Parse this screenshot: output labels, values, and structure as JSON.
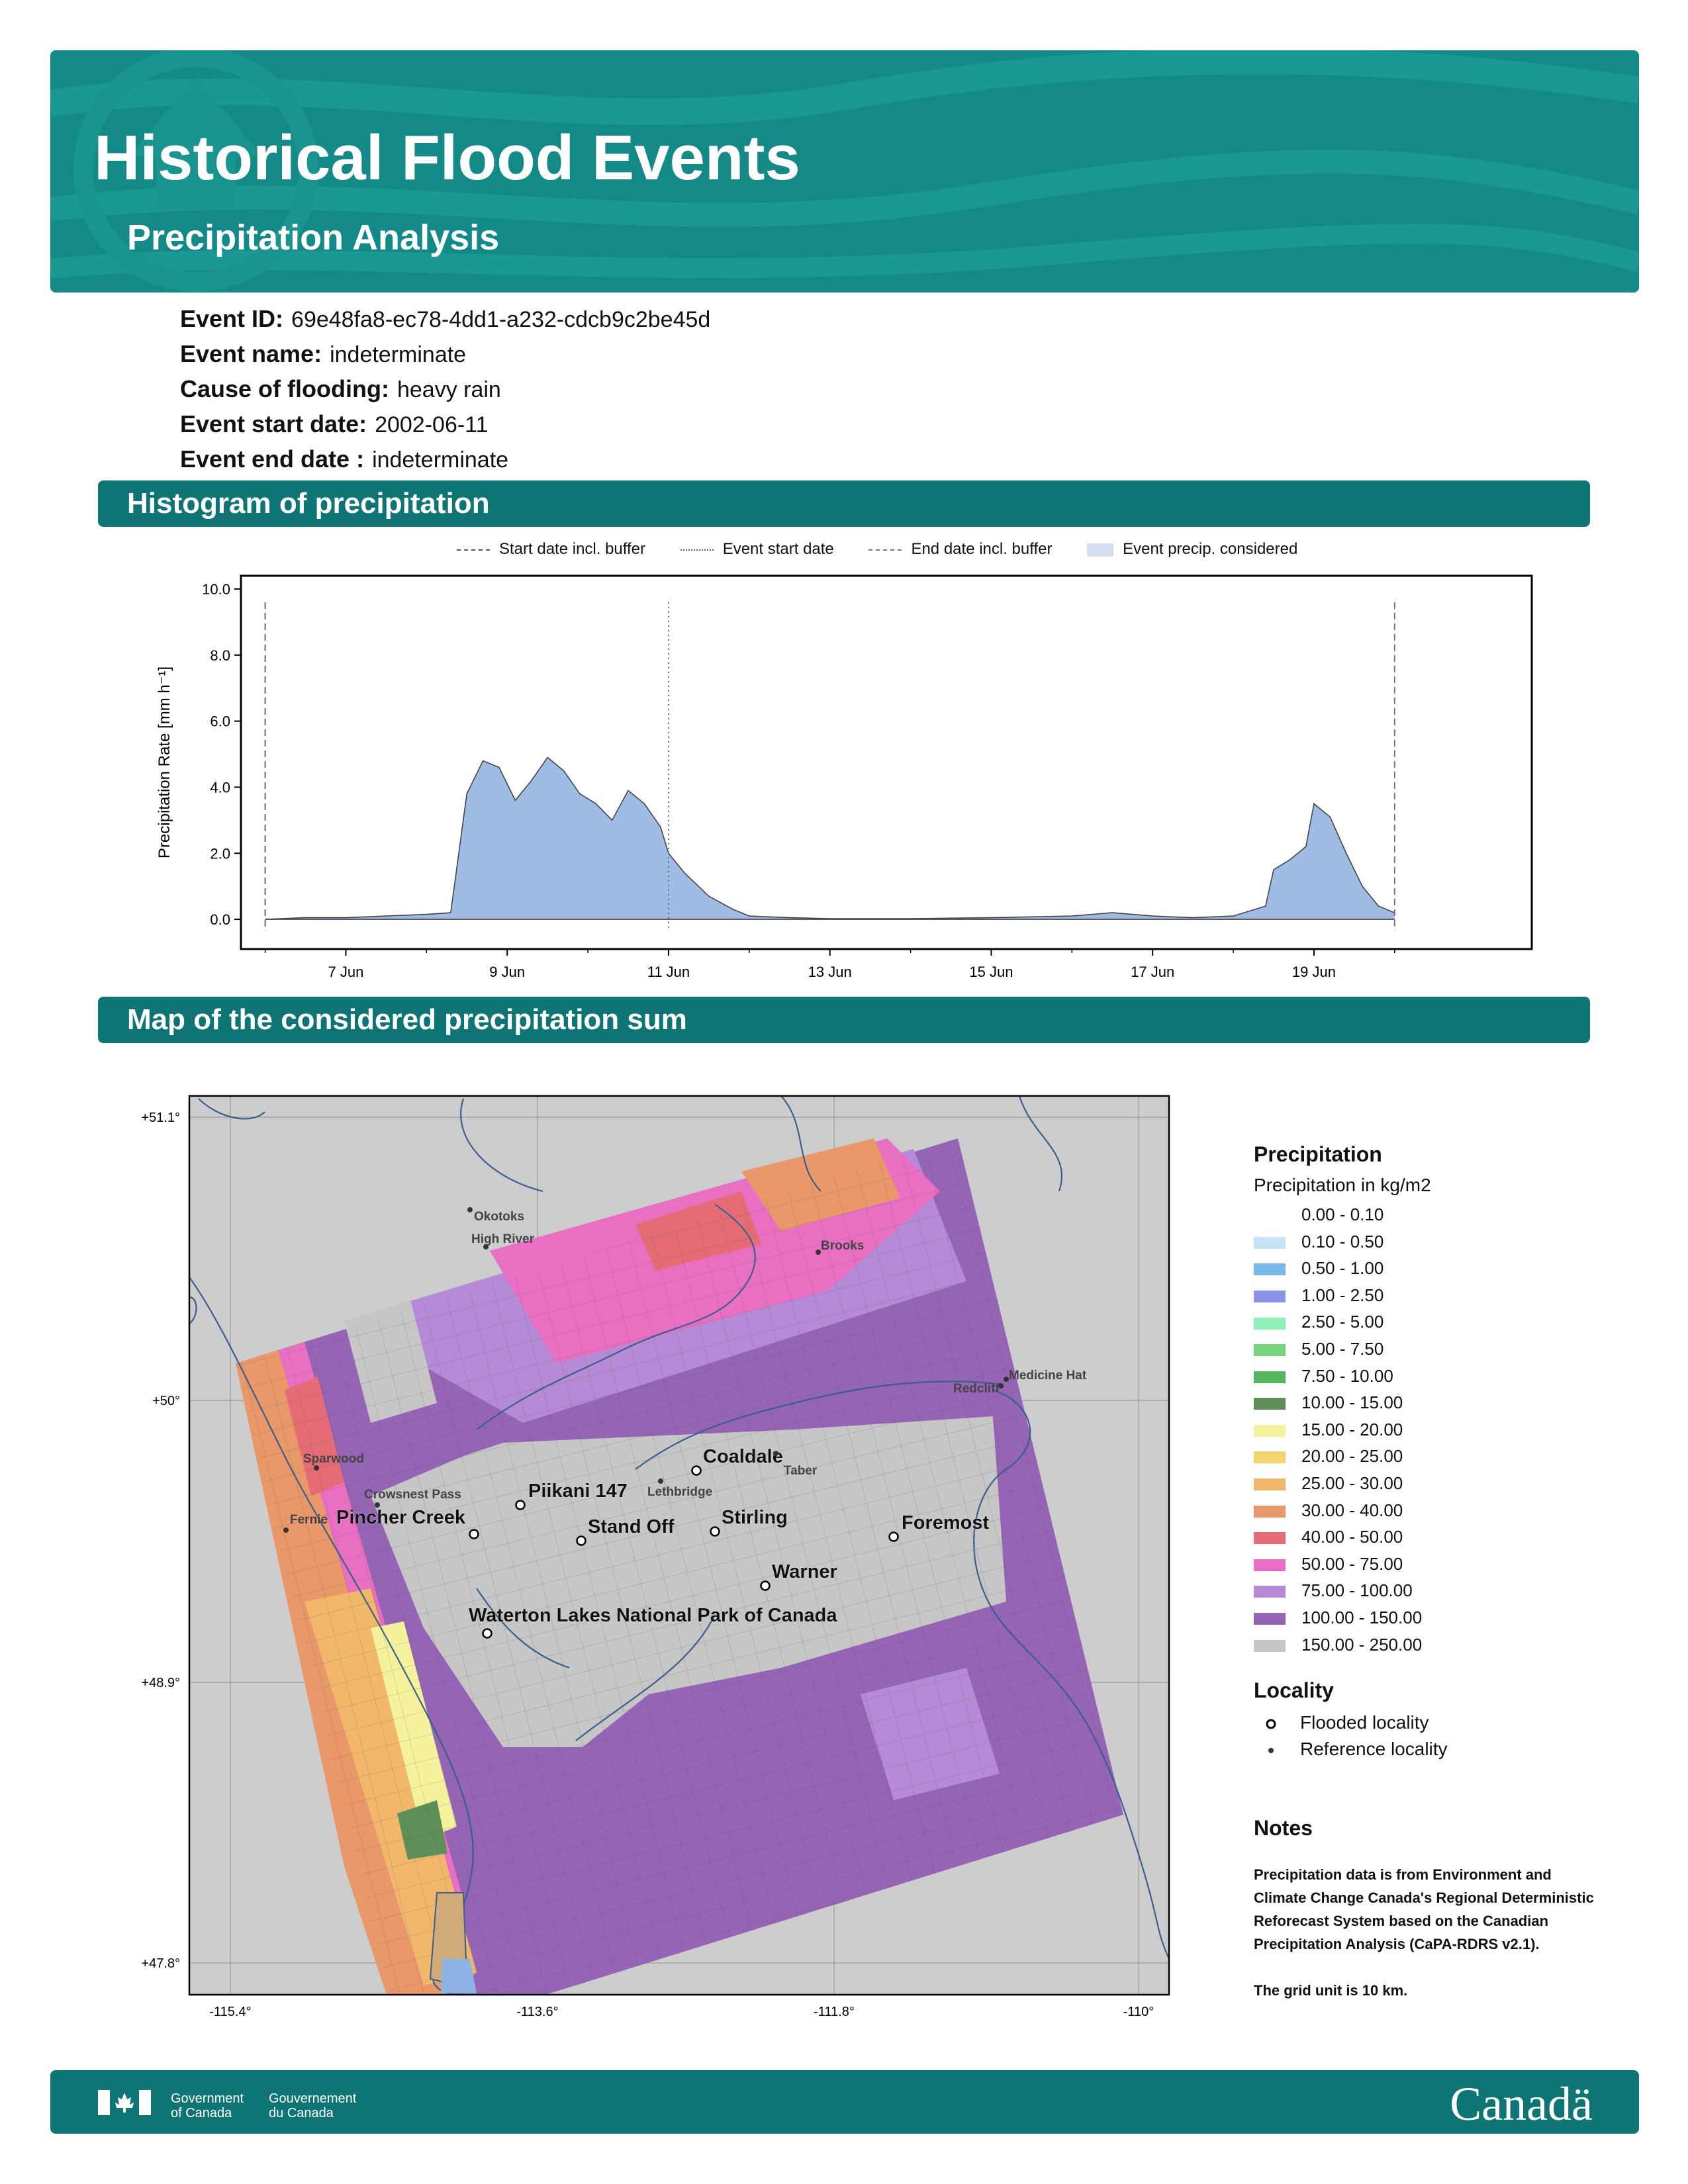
{
  "header": {
    "title": "Historical Flood Events",
    "subtitle": "Precipitation Analysis"
  },
  "event": {
    "id_label": "Event ID:",
    "id_value": "69e48fa8-ec78-4dd1-a232-cdcb9c2be45d",
    "name_label": "Event name:",
    "name_value": "indeterminate",
    "cause_label": "Cause of flooding:",
    "cause_value": "heavy rain",
    "start_label": "Event start date:",
    "start_value": "2002-06-11",
    "end_label": "Event end date :",
    "end_value": "indeterminate"
  },
  "sections": {
    "histogram": "Histogram of precipitation",
    "map": "Map of the considered precipitation sum"
  },
  "chart_legend": {
    "start_buffer": "Start date incl. buffer",
    "event_start": "Event start date",
    "end_buffer": "End date incl. buffer",
    "event_precip": "Event precip. considered"
  },
  "chart_data": [
    {
      "type": "area",
      "title": "",
      "xlabel": "",
      "ylabel": "Precipitation Rate [mm h⁻¹]",
      "ylim": [
        -0.9,
        10.4
      ],
      "yticks": [
        "0.0",
        "2.0",
        "4.0",
        "6.0",
        "8.0",
        "10.0"
      ],
      "xticks": [
        "7 Jun",
        "9 Jun",
        "11 Jun",
        "13 Jun",
        "15 Jun",
        "17 Jun",
        "19 Jun"
      ],
      "xlim_days": [
        5.7,
        21.7
      ],
      "x_unit": "days of June 2002",
      "markers": {
        "start_buffer": 6.0,
        "event_start": 11.0,
        "end_buffer": 20.0
      },
      "series": [
        {
          "x": [
            6.0,
            6.5,
            7.0,
            7.5,
            8.0,
            8.3,
            8.5,
            8.7,
            8.9,
            9.1,
            9.3,
            9.5,
            9.7,
            9.9,
            10.1,
            10.3,
            10.5,
            10.7,
            10.9,
            11.0,
            11.2,
            11.5,
            11.8,
            12.0,
            12.5,
            13.0,
            14.0,
            15.0,
            16.0,
            16.5,
            17.0,
            17.5,
            18.0,
            18.4,
            18.5,
            18.7,
            18.9,
            19.0,
            19.2,
            19.4,
            19.6,
            19.8,
            20.0
          ],
          "values": [
            0.0,
            0.05,
            0.05,
            0.1,
            0.15,
            0.2,
            3.8,
            4.8,
            4.6,
            3.6,
            4.2,
            4.9,
            4.5,
            3.8,
            3.5,
            3.0,
            3.9,
            3.5,
            2.8,
            2.0,
            1.4,
            0.7,
            0.3,
            0.1,
            0.05,
            0.02,
            0.02,
            0.05,
            0.1,
            0.2,
            0.1,
            0.05,
            0.1,
            0.4,
            1.5,
            1.8,
            2.2,
            3.5,
            3.1,
            2.0,
            1.0,
            0.4,
            0.2
          ]
        }
      ]
    }
  ],
  "map": {
    "lat_labels": [
      "+51.1°",
      "+50°",
      "+48.9°",
      "+47.8°"
    ],
    "lon_labels": [
      "-115.4°",
      "-113.6°",
      "-111.8°",
      "-110°"
    ],
    "flooded": [
      {
        "name": "Coaldale"
      },
      {
        "name": "Piikani 147"
      },
      {
        "name": "Pincher Creek"
      },
      {
        "name": "Stand Off"
      },
      {
        "name": "Stirling"
      },
      {
        "name": "Foremost"
      },
      {
        "name": "Warner"
      },
      {
        "name": "Waterton Lakes National Park of Canada"
      }
    ],
    "reference": [
      {
        "name": "Okotoks"
      },
      {
        "name": "High River"
      },
      {
        "name": "Brooks"
      },
      {
        "name": "Medicine Hat"
      },
      {
        "name": "Redcliff"
      },
      {
        "name": "Taber"
      },
      {
        "name": "Lethbridge"
      },
      {
        "name": "Sparwood"
      },
      {
        "name": "Crowsnest Pass"
      },
      {
        "name": "Fernie"
      }
    ]
  },
  "precip_legend": {
    "title": "Precipitation",
    "subtitle": "Precipitation in kg/m2",
    "items": [
      {
        "label": "0.00 - 0.10",
        "color": "#ffffff"
      },
      {
        "label": "0.10 - 0.50",
        "color": "#c8e2f6"
      },
      {
        "label": "0.50 - 1.00",
        "color": "#7ab8ea"
      },
      {
        "label": "1.00 - 2.50",
        "color": "#8a94e6"
      },
      {
        "label": "2.50 - 5.00",
        "color": "#8ef0b6"
      },
      {
        "label": "5.00 - 7.50",
        "color": "#73d67e"
      },
      {
        "label": "7.50 - 10.00",
        "color": "#54b55c"
      },
      {
        "label": "10.00 - 15.00",
        "color": "#5f8f58"
      },
      {
        "label": "15.00 - 20.00",
        "color": "#f4f29c"
      },
      {
        "label": "20.00 - 25.00",
        "color": "#f2d66c"
      },
      {
        "label": "25.00 - 30.00",
        "color": "#f1b86a"
      },
      {
        "label": "30.00 - 40.00",
        "color": "#e9986a"
      },
      {
        "label": "40.00 - 50.00",
        "color": "#e56c74"
      },
      {
        "label": "50.00 - 75.00",
        "color": "#e96fc2"
      },
      {
        "label": "75.00 - 100.00",
        "color": "#b58ad6"
      },
      {
        "label": "100.00 - 150.00",
        "color": "#9564b4"
      },
      {
        "label": "150.00 - 250.00",
        "color": "#c6c6c6"
      }
    ]
  },
  "locality_legend": {
    "title": "Locality",
    "flooded": "Flooded locality",
    "reference": "Reference locality"
  },
  "notes": {
    "title": "Notes",
    "text1": "Precipitation data is from Environment and Climate Change Canada's Regional Deterministic Reforecast System based on the Canadian Precipitation Analysis (CaPA-RDRS v2.1).",
    "text2": "The grid unit is 10 km."
  },
  "footer": {
    "gov_en_1": "Government",
    "gov_en_2": "of Canada",
    "gov_fr_1": "Gouvernement",
    "gov_fr_2": "du Canada",
    "wordmark": "Canadä"
  }
}
